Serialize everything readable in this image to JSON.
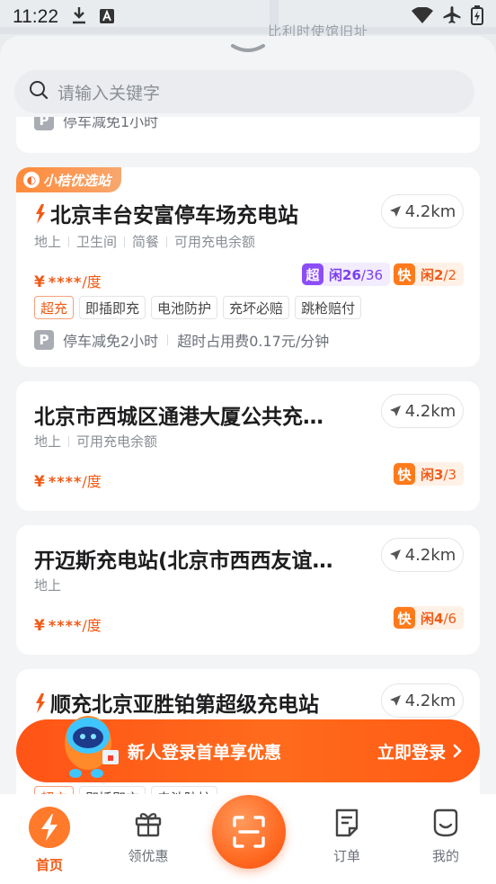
{
  "status": {
    "time": "11:22"
  },
  "map": {
    "label": "比利时使馆旧址"
  },
  "search": {
    "placeholder": "请输入关键字"
  },
  "partial_top": {
    "park_text": "停车减免1小时"
  },
  "stations": [
    {
      "ribbon": "小桔优选站",
      "name": "北京丰台安富停车场充电站",
      "distance": "4.2km",
      "amenities": [
        "地上",
        "卫生间",
        "简餐",
        "可用充电余额"
      ],
      "price_symbol": "¥",
      "price_masked": "****",
      "price_unit": "/度",
      "super": {
        "badge": "超",
        "free_label": "闲",
        "free": "26",
        "total": "/36"
      },
      "fast": {
        "badge": "快",
        "free_label": "闲",
        "free": "2",
        "total": "/2"
      },
      "tags": [
        "超充",
        "即插即充",
        "电池防护",
        "充坏必赔",
        "跳枪赔付"
      ],
      "parking": {
        "icon": "P",
        "text": "停车减免2小时",
        "extra": "超时占用费0.17元/分钟"
      }
    },
    {
      "name": "北京市西城区通港大厦公共充…",
      "distance": "4.2km",
      "amenities": [
        "地上",
        "可用充电余额"
      ],
      "price_symbol": "¥",
      "price_masked": "****",
      "price_unit": "/度",
      "fast": {
        "badge": "快",
        "free_label": "闲",
        "free": "3",
        "total": "/3"
      }
    },
    {
      "name": "开迈斯充电站(北京市西西友谊…",
      "distance": "4.2km",
      "amenities": [
        "地上"
      ],
      "price_symbol": "¥",
      "price_masked": "****",
      "price_unit": "/度",
      "fast": {
        "badge": "快",
        "free_label": "闲",
        "free": "4",
        "total": "/6"
      }
    },
    {
      "name": "顺充北京亚胜铂第超级充电站",
      "distance": "4.2km",
      "tags": [
        "超充",
        "即插即充",
        "电池防护"
      ]
    }
  ],
  "promo": {
    "text": "新人登录首单享优惠",
    "cta": "立即登录"
  },
  "tabs": [
    {
      "label": "首页",
      "icon": "bolt-icon"
    },
    {
      "label": "领优惠",
      "icon": "gift-icon"
    },
    {
      "label": "订单",
      "icon": "order-icon"
    },
    {
      "label": "我的",
      "icon": "profile-icon"
    }
  ],
  "colors": {
    "accent": "#F15A16",
    "super_badge": "#8C4DF6",
    "fast_badge": "#FF7A1A"
  }
}
